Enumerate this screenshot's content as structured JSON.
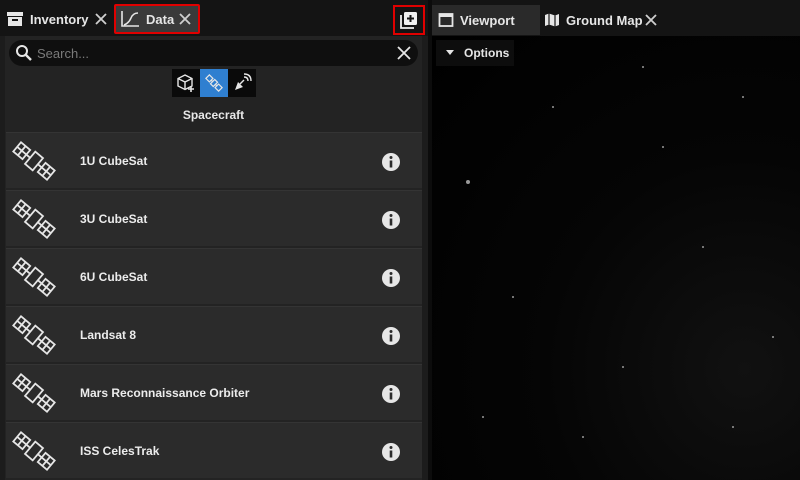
{
  "left_tabs": {
    "inventory": {
      "label": "Inventory"
    },
    "data": {
      "label": "Data"
    }
  },
  "search": {
    "placeholder": "Search..."
  },
  "filters": [
    "cube-add",
    "satellite",
    "antenna"
  ],
  "category_title": "Spacecraft",
  "spacecraft": [
    {
      "name": "1U CubeSat"
    },
    {
      "name": "3U CubeSat"
    },
    {
      "name": "6U CubeSat"
    },
    {
      "name": "Landsat 8"
    },
    {
      "name": "Mars Reconnaissance Orbiter"
    },
    {
      "name": "ISS CelesTrak"
    }
  ],
  "right_tabs": {
    "viewport": {
      "label": "Viewport"
    },
    "ground_map": {
      "label": "Ground Map"
    }
  },
  "options": {
    "label": "Options"
  },
  "colors": {
    "highlight": "#e00000",
    "active_filter": "#2f7fd0"
  }
}
